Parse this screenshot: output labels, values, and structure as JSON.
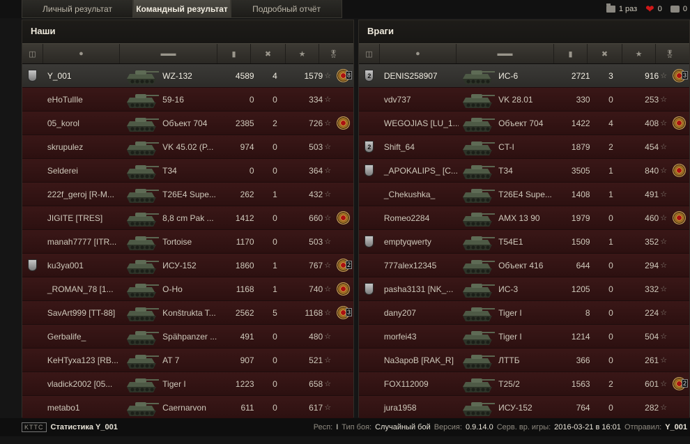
{
  "tabs": [
    {
      "label": "Личный результат"
    },
    {
      "label": "Командный результат"
    },
    {
      "label": "Подробный отчёт"
    }
  ],
  "top_right": {
    "battles": "1 раз",
    "likes": "0",
    "messages": "0"
  },
  "left": {
    "title": "Наши",
    "rows": [
      {
        "name": "Y_001",
        "vehicle": "WZ-132",
        "damage": "4589",
        "frags": "4",
        "xp": "1579",
        "badge": "yes",
        "medal": "yes",
        "medal_count": "8",
        "me": "yes"
      },
      {
        "name": "eHoTulIle",
        "vehicle": "59-16",
        "damage": "0",
        "frags": "0",
        "xp": "334"
      },
      {
        "name": "05_korol",
        "vehicle": "Объект 704",
        "damage": "2385",
        "frags": "2",
        "xp": "726",
        "medal": "yes"
      },
      {
        "name": "skrupulez",
        "vehicle": "VK 45.02 (P...",
        "damage": "974",
        "frags": "0",
        "xp": "503"
      },
      {
        "name": "Selderei",
        "vehicle": "T34",
        "damage": "0",
        "frags": "0",
        "xp": "364"
      },
      {
        "name": "222f_geroj [R-M...",
        "vehicle": "T26E4 Supe...",
        "damage": "262",
        "frags": "1",
        "xp": "432"
      },
      {
        "name": "JIGITE [TRES]",
        "vehicle": "8,8 cm Pak ...",
        "damage": "1412",
        "frags": "0",
        "xp": "660",
        "medal": "yes"
      },
      {
        "name": "manah7777 [ITR...",
        "vehicle": "Tortoise",
        "damage": "1170",
        "frags": "0",
        "xp": "503"
      },
      {
        "name": "ku3ya001",
        "vehicle": "ИСУ-152",
        "damage": "1860",
        "frags": "1",
        "xp": "767",
        "badge": "yes",
        "medal": "yes",
        "medal_count": "2"
      },
      {
        "name": "_ROMAN_78 [1...",
        "vehicle": "O-Ho",
        "damage": "1168",
        "frags": "1",
        "xp": "740",
        "medal": "yes"
      },
      {
        "name": "SavArt999 [TT-88]",
        "vehicle": "Konštrukta T...",
        "damage": "2562",
        "frags": "5",
        "xp": "1168",
        "medal": "yes",
        "medal_count": "3"
      },
      {
        "name": "Gerbalife_",
        "vehicle": "Spähpanzer ...",
        "damage": "491",
        "frags": "0",
        "xp": "480"
      },
      {
        "name": "KeHTyxa123 [RB...",
        "vehicle": "AT 7",
        "damage": "907",
        "frags": "0",
        "xp": "521"
      },
      {
        "name": "vladick2002 [05...",
        "vehicle": "Tiger I",
        "damage": "1223",
        "frags": "0",
        "xp": "658"
      },
      {
        "name": "metabo1",
        "vehicle": "Caernarvon",
        "damage": "611",
        "frags": "0",
        "xp": "617"
      }
    ]
  },
  "right": {
    "title": "Враги",
    "rows": [
      {
        "name": "DENIS258907",
        "vehicle": "ИС-6",
        "damage": "2721",
        "frags": "3",
        "xp": "916",
        "badge": "yes",
        "badge_num": "2",
        "medal": "yes",
        "medal_count": "3",
        "me": "yes"
      },
      {
        "name": "vdv737",
        "vehicle": "VK 28.01",
        "damage": "330",
        "frags": "0",
        "xp": "253"
      },
      {
        "name": "WEGOJIAS [LU_1...",
        "vehicle": "Объект 704",
        "damage": "1422",
        "frags": "4",
        "xp": "408",
        "medal": "yes"
      },
      {
        "name": "Shift_64",
        "vehicle": "CT-I",
        "damage": "1879",
        "frags": "2",
        "xp": "454",
        "badge": "yes",
        "badge_num": "2"
      },
      {
        "name": "_APOKALIPS_ [C...",
        "vehicle": "T34",
        "damage": "3505",
        "frags": "1",
        "xp": "840",
        "badge": "yes",
        "medal": "yes"
      },
      {
        "name": "_Chekushka_",
        "vehicle": "T26E4 Supe...",
        "damage": "1408",
        "frags": "1",
        "xp": "491"
      },
      {
        "name": "Romeo2284",
        "vehicle": "AMX 13 90",
        "damage": "1979",
        "frags": "0",
        "xp": "460",
        "medal": "yes"
      },
      {
        "name": "emptyqwerty",
        "vehicle": "T54E1",
        "damage": "1509",
        "frags": "1",
        "xp": "352",
        "badge": "yes"
      },
      {
        "name": "777alex12345",
        "vehicle": "Объект 416",
        "damage": "644",
        "frags": "0",
        "xp": "294"
      },
      {
        "name": "pasha3131 [NK_...",
        "vehicle": "ИС-3",
        "damage": "1205",
        "frags": "0",
        "xp": "332",
        "badge": "yes"
      },
      {
        "name": "dany207",
        "vehicle": "Tiger I",
        "damage": "8",
        "frags": "0",
        "xp": "224"
      },
      {
        "name": "morfei43",
        "vehicle": "Tiger I",
        "damage": "1214",
        "frags": "0",
        "xp": "504"
      },
      {
        "name": "Na3apoB [RAK_R]",
        "vehicle": "ЛТТБ",
        "damage": "366",
        "frags": "0",
        "xp": "261"
      },
      {
        "name": "FOX112009",
        "vehicle": "T25/2",
        "damage": "1563",
        "frags": "2",
        "xp": "601",
        "medal": "yes",
        "medal_count": "2"
      },
      {
        "name": "jura1958",
        "vehicle": "ИСУ-152",
        "damage": "764",
        "frags": "0",
        "xp": "282"
      }
    ]
  },
  "footer": {
    "logo": "KTTC",
    "title": "Статистика Y_001",
    "server_label": "Респ:",
    "server": "I",
    "battle_type_label": "Тип боя:",
    "battle_type": "Случайный бой",
    "version_label": "Версия:",
    "version": "0.9.14.0",
    "time_label": "Серв. вр. игры:",
    "time": "2016-03-21 в 16:01",
    "sender_label": "Отправил:",
    "sender": "Y_001"
  }
}
